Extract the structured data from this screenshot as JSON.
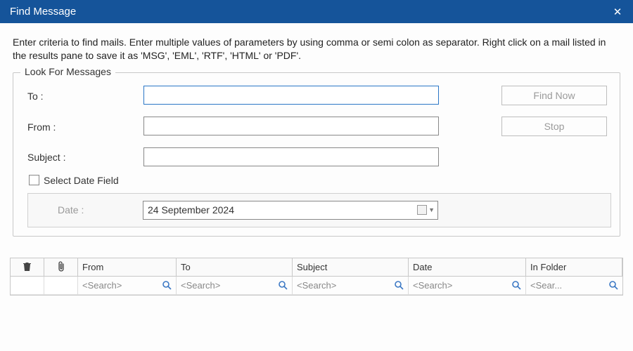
{
  "window": {
    "title": "Find Message"
  },
  "instructions": "Enter criteria to find mails. Enter multiple values of parameters by using comma or semi colon as separator. Right click on a mail listed in the results pane to save it as 'MSG', 'EML', 'RTF', 'HTML' or 'PDF'.",
  "form": {
    "legend": "Look For Messages",
    "to_label": "To :",
    "to_value": "",
    "from_label": "From :",
    "from_value": "",
    "subject_label": "Subject :",
    "subject_value": "",
    "select_date_label": "Select Date Field",
    "date_label": "Date :",
    "date_value": "24 September 2024",
    "find_now_label": "Find Now",
    "stop_label": "Stop"
  },
  "results": {
    "columns": {
      "from": "From",
      "to": "To",
      "subject": "Subject",
      "date": "Date",
      "infolder": "In Folder"
    },
    "search_placeholder": "<Search>",
    "search_placeholder_short": "<Sear..."
  }
}
